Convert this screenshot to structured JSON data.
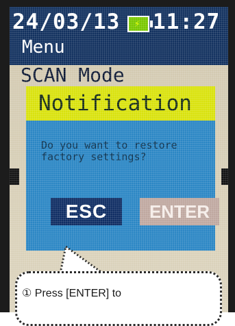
{
  "status": {
    "date": "24/03/13",
    "time": "11:27",
    "battery_icon": "battery-charging-icon"
  },
  "menu": {
    "title": "Menu",
    "mode": "SCAN Mode"
  },
  "dialog": {
    "title": "Notification",
    "message": "Do you want to restore factory settings?",
    "esc_label": "ESC",
    "enter_label": "ENTER"
  },
  "callout": {
    "text": "① Press [ENTER] to"
  },
  "colors": {
    "header_bg": "#12315f",
    "dialog_bg": "#2a86c4",
    "dialog_header_bg": "#d9e20c",
    "esc_bg": "#0f2d63",
    "enter_bg": "#bfa8a0"
  }
}
